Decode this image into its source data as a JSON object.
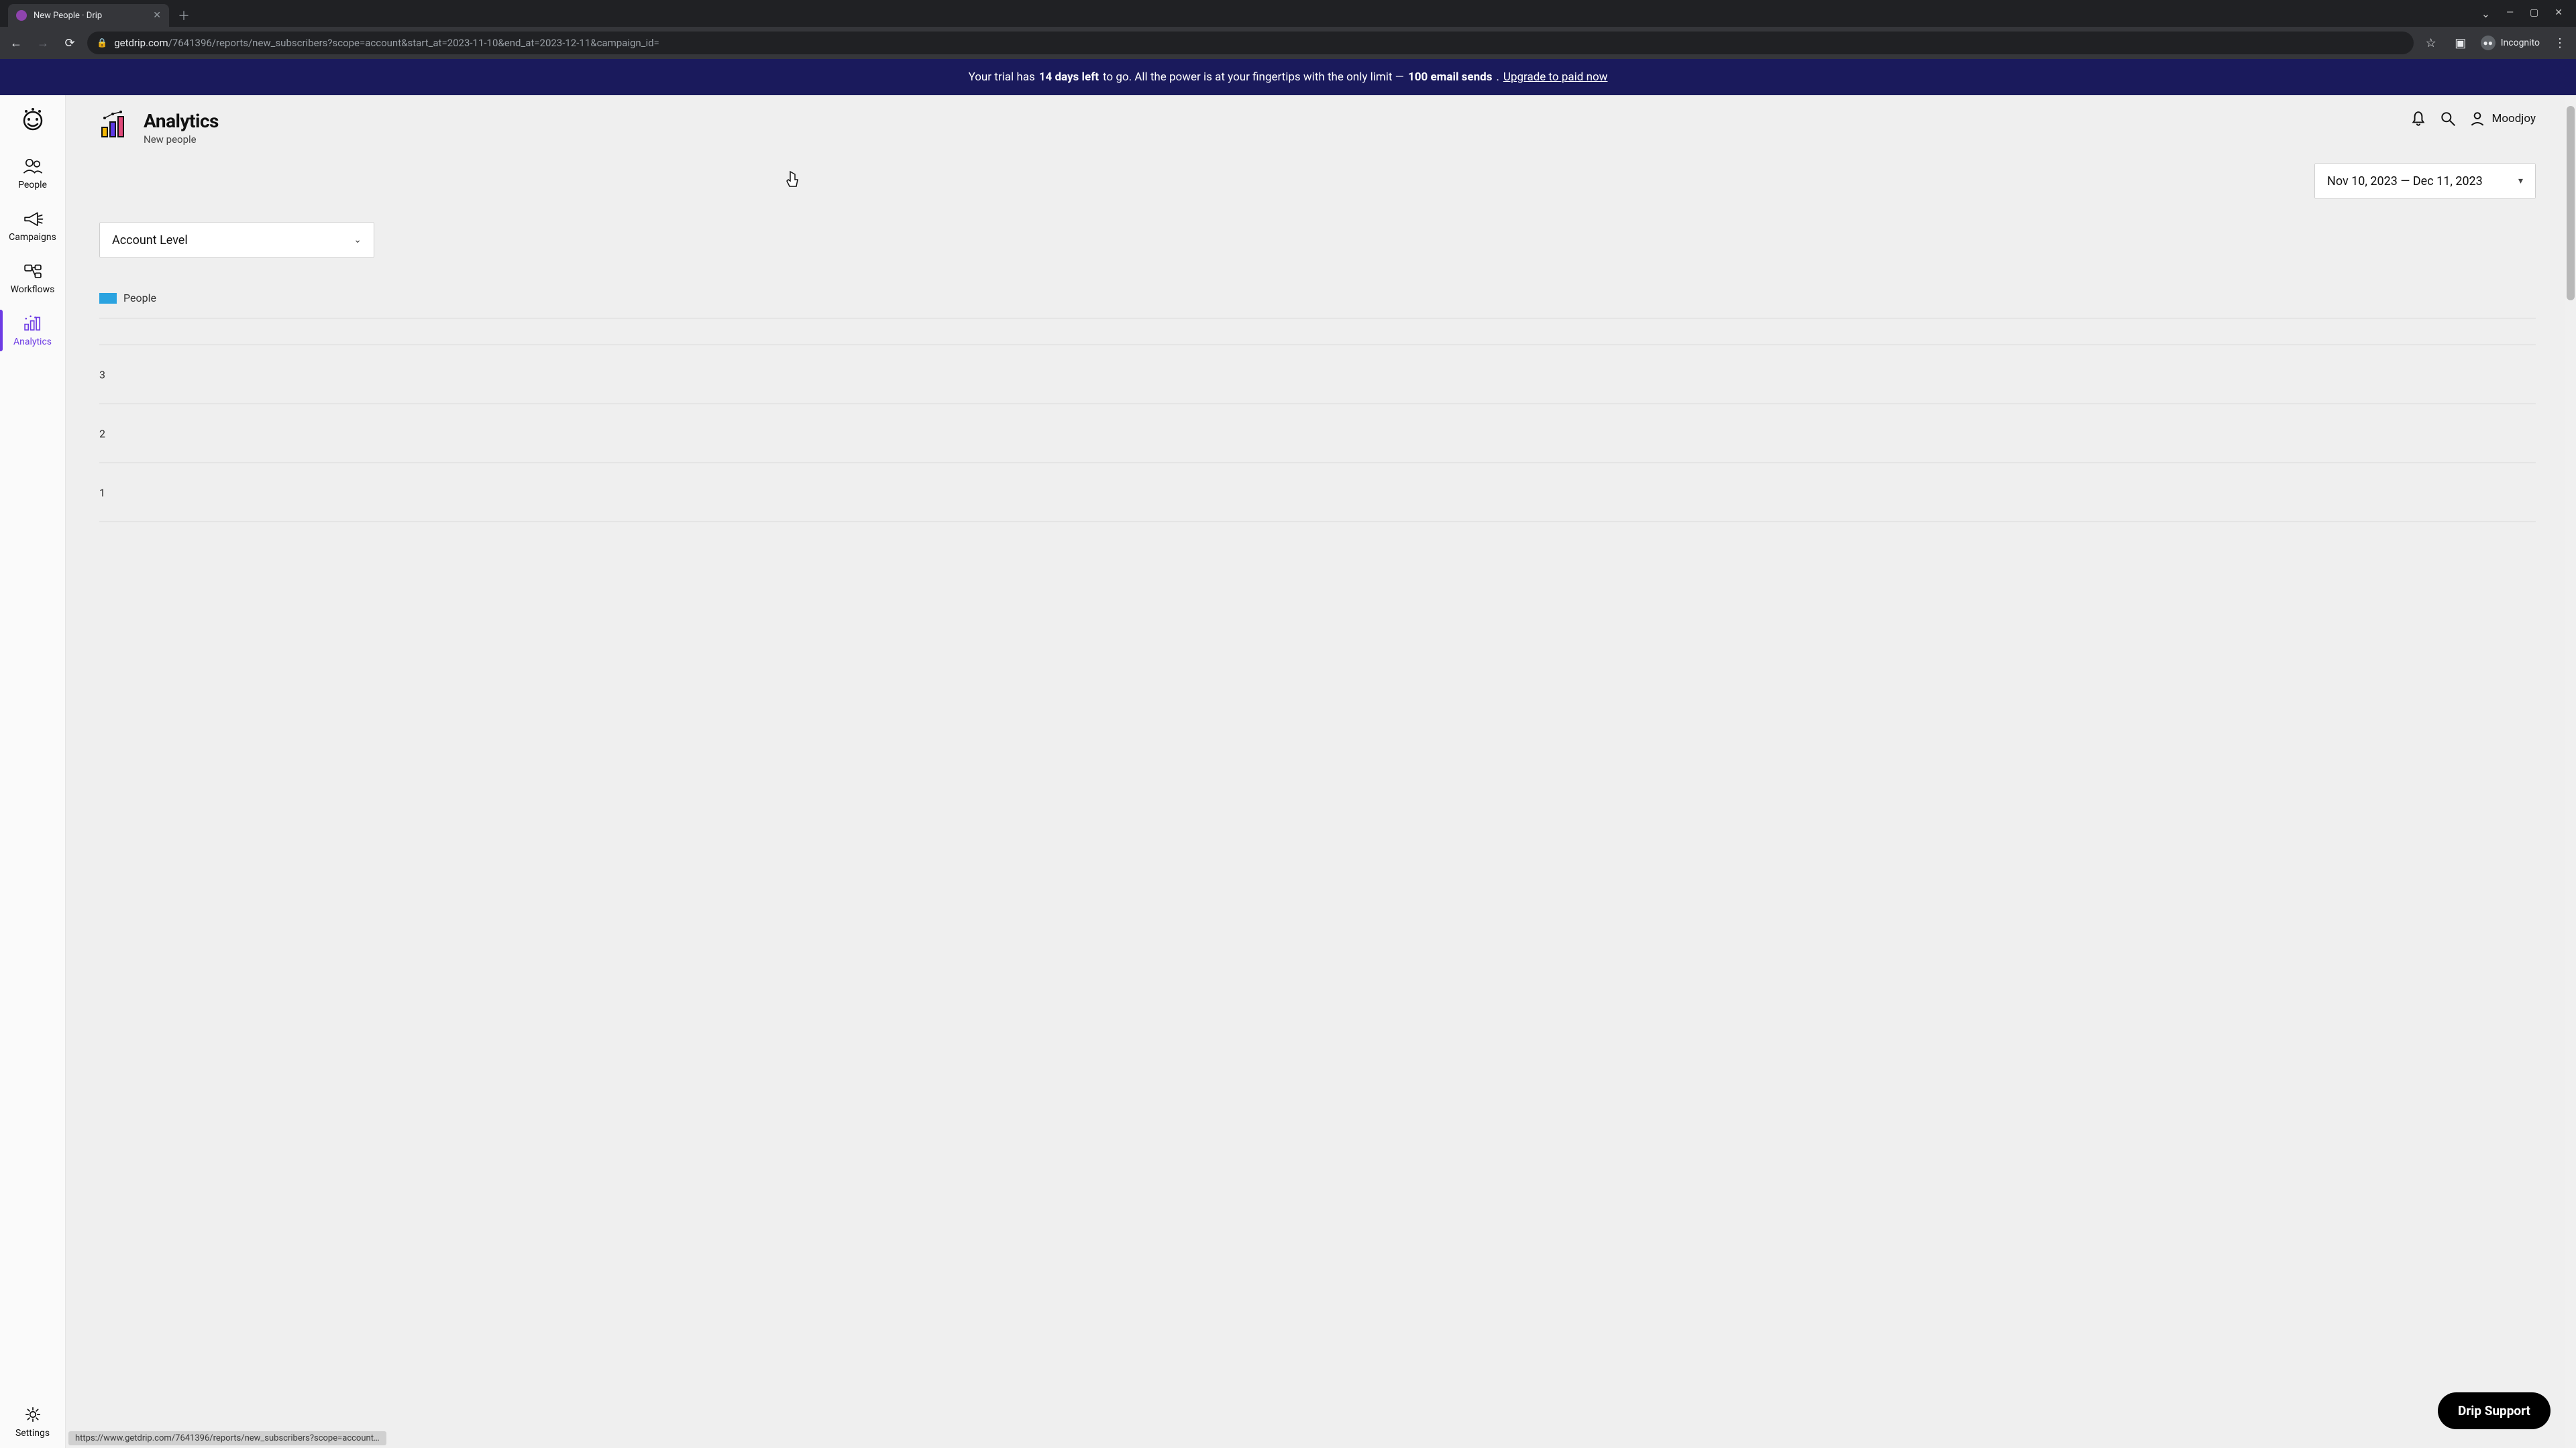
{
  "browser": {
    "tab_title": "New People · Drip",
    "url_domain": "getdrip.com",
    "url_path": "/7641396/reports/new_subscribers?scope=account&start_at=2023-11-10&end_at=2023-12-11&campaign_id=",
    "incognito_label": "Incognito"
  },
  "banner": {
    "prefix": "Your trial has ",
    "bold1": "14 days left",
    "mid": " to go. All the power is at your fingertips with the only limit — ",
    "bold2": "100 email sends",
    "suffix": ". ",
    "link": "Upgrade to paid now"
  },
  "sidebar": {
    "items": [
      {
        "label": "People"
      },
      {
        "label": "Campaigns"
      },
      {
        "label": "Workflows"
      },
      {
        "label": "Analytics"
      },
      {
        "label": "Settings"
      }
    ]
  },
  "header": {
    "title": "Analytics",
    "subtitle": "New people",
    "user": "Moodjoy"
  },
  "controls": {
    "date_range": "Nov 10, 2023 — Dec 11, 2023",
    "scope": "Account Level"
  },
  "support_label": "Drip Support",
  "status_url": "https://www.getdrip.com/7641396/reports/new_subscribers?scope=account…",
  "chart_data": {
    "type": "line",
    "title": "",
    "legend": [
      "People"
    ],
    "legend_colors": [
      "#2aa3e0"
    ],
    "ylabel": "",
    "xlabel": "",
    "ylim": [
      0,
      3
    ],
    "y_ticks": [
      3,
      2,
      1
    ],
    "series": [
      {
        "name": "People",
        "values": []
      }
    ],
    "categories": []
  }
}
